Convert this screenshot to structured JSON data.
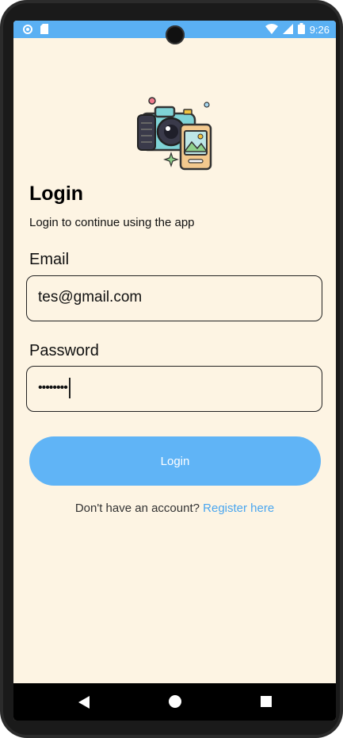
{
  "status_bar": {
    "time": "9:26",
    "icons": [
      "settings-dot-icon",
      "sim-card-icon",
      "wifi-icon",
      "signal-icon",
      "battery-icon"
    ],
    "color": "#5ab0f3"
  },
  "header": {
    "logo_icon": "camera-phone-illustration",
    "title": "Login",
    "subtitle": "Login to continue using the app"
  },
  "form": {
    "email_label": "Email",
    "email_value": "tes@gmail.com",
    "password_label": "Password",
    "password_value": "••••••••",
    "login_button": "Login"
  },
  "footer": {
    "prompt": "Don't have an account?",
    "register_link": "Register here",
    "link_color": "#4aa6ef"
  },
  "nav": {
    "icons": [
      "back-icon",
      "home-icon",
      "recents-icon"
    ]
  },
  "theme": {
    "background": "#fdf4e3",
    "accent": "#60b4f6"
  }
}
